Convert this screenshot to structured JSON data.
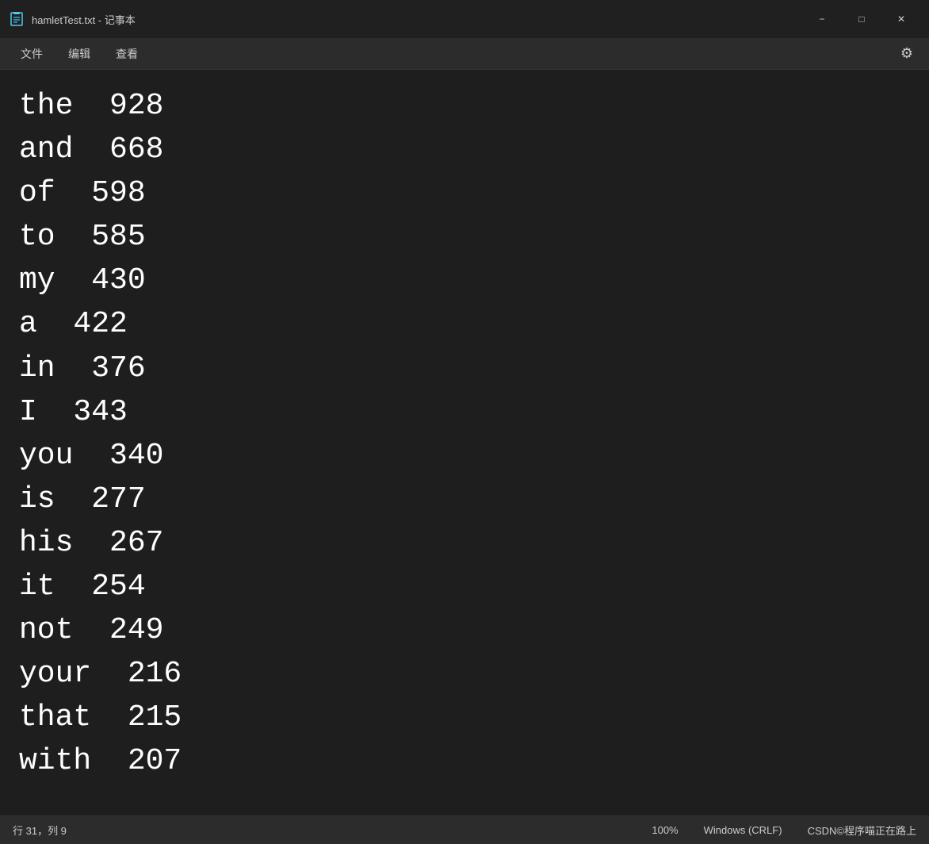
{
  "titlebar": {
    "title": "hamletTest.txt - 记事本",
    "minimize_label": "−",
    "maximize_label": "□",
    "close_label": "✕"
  },
  "menubar": {
    "items": [
      {
        "label": "文件"
      },
      {
        "label": "编辑"
      },
      {
        "label": "查看"
      }
    ],
    "settings_icon": "⚙"
  },
  "content": {
    "word_counts": [
      {
        "word": "the",
        "count": "928"
      },
      {
        "word": "and",
        "count": "668"
      },
      {
        "word": "of",
        "count": "598"
      },
      {
        "word": "to",
        "count": "585"
      },
      {
        "word": "my",
        "count": "430"
      },
      {
        "word": "a",
        "count": "422"
      },
      {
        "word": "in",
        "count": "376"
      },
      {
        "word": "I",
        "count": "343"
      },
      {
        "word": "you",
        "count": "340"
      },
      {
        "word": "is",
        "count": "277"
      },
      {
        "word": "his",
        "count": "267"
      },
      {
        "word": "it",
        "count": "254"
      },
      {
        "word": "not",
        "count": "249"
      },
      {
        "word": "your",
        "count": "216"
      },
      {
        "word": "that",
        "count": "215"
      },
      {
        "word": "with",
        "count": "207"
      }
    ]
  },
  "statusbar": {
    "position": "行 31，列 9",
    "zoom": "100%",
    "line_ending": "Windows (CRLF)",
    "encoding": "CSDN©程序喵正在路上"
  }
}
